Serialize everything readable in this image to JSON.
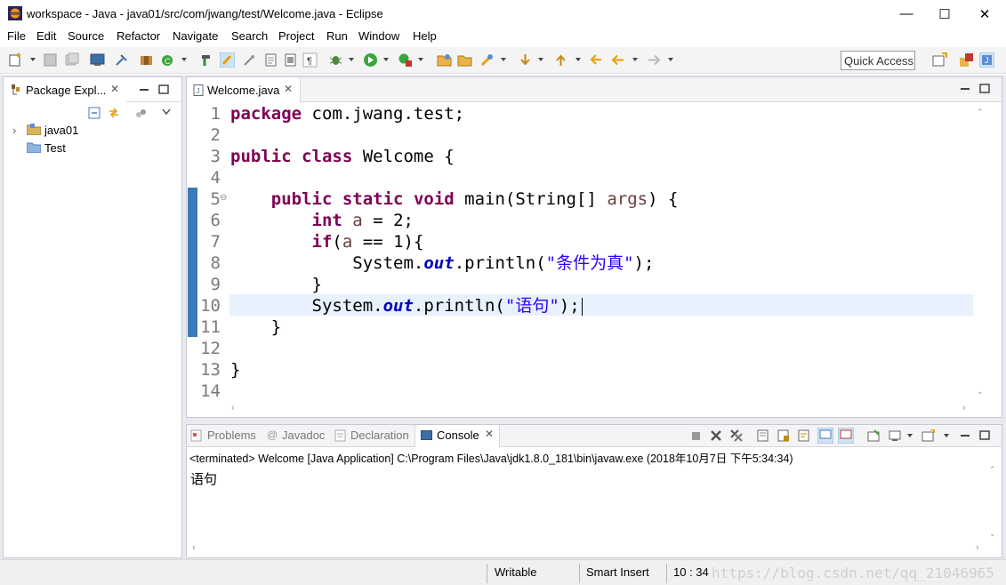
{
  "window": {
    "title": "workspace - Java - java01/src/com/jwang/test/Welcome.java - Eclipse",
    "minimize": "—",
    "maximize": "☐",
    "close": "✕"
  },
  "menu": [
    "File",
    "Edit",
    "Source",
    "Refactor",
    "Navigate",
    "Search",
    "Project",
    "Run",
    "Window",
    "Help"
  ],
  "toolbar": {
    "quick_access_placeholder": "Quick Access"
  },
  "package_explorer": {
    "tab_label": "Package Expl...",
    "close": "✕",
    "tree": [
      {
        "label": "java01",
        "expander": "›"
      },
      {
        "label": "Test",
        "expander": ""
      }
    ]
  },
  "editor": {
    "tab_label": "Welcome.java",
    "close": "✕",
    "fold_marker": "⊖",
    "line_numbers": [
      "1",
      "2",
      "3",
      "4",
      "5",
      "6",
      "7",
      "8",
      "9",
      "10",
      "11",
      "12",
      "13",
      "14"
    ],
    "current_line": 10,
    "code_tokens": {
      "l1_kw": "package",
      "l1_rest": " com.jwang.test;",
      "l3_kw1": "public",
      "l3_kw2": "class",
      "l3_rest": " Welcome {",
      "l5_indent": "    ",
      "l5_kw1": "public",
      "l5_kw2": "static",
      "l5_kw3": "void",
      "l5_rest1": " main(String[] ",
      "l5_var": "args",
      "l5_rest2": ") {",
      "l6_indent": "        ",
      "l6_kw": "int",
      "l6_var": "a",
      "l6_rest": " = 2;",
      "l7_indent": "        ",
      "l7_kw": "if",
      "l7_rest1": "(",
      "l7_var": "a",
      "l7_rest2": " == 1){",
      "l8_indent": "            ",
      "l8_sys": "System.",
      "l8_fld": "out",
      "l8_mid": ".println(",
      "l8_str": "\"条件为真\"",
      "l8_end": ");",
      "l9": "        }",
      "l10_indent": "        ",
      "l10_sys": "System.",
      "l10_fld": "out",
      "l10_mid": ".println(",
      "l10_str": "\"语句\"",
      "l10_end": ");",
      "l11": "    }",
      "l13": "}"
    }
  },
  "console": {
    "tabs": [
      "Problems",
      "Javadoc",
      "Declaration",
      "Console"
    ],
    "active_tab": "Console",
    "close": "✕",
    "header": "<terminated> Welcome [Java Application] C:\\Program Files\\Java\\jdk1.8.0_181\\bin\\javaw.exe (2018年10月7日 下午5:34:34)",
    "output": "语句"
  },
  "statusbar": {
    "writable": "Writable",
    "insert_mode": "Smart Insert",
    "position": "10 : 34",
    "watermark": "https://blog.csdn.net/qq_21046965"
  },
  "colors": {
    "keyword": "#7f0055",
    "string": "#2a00ff",
    "field": "#0000c0",
    "current_line": "#e8f2fe",
    "change_bar": "#3c79b8"
  }
}
